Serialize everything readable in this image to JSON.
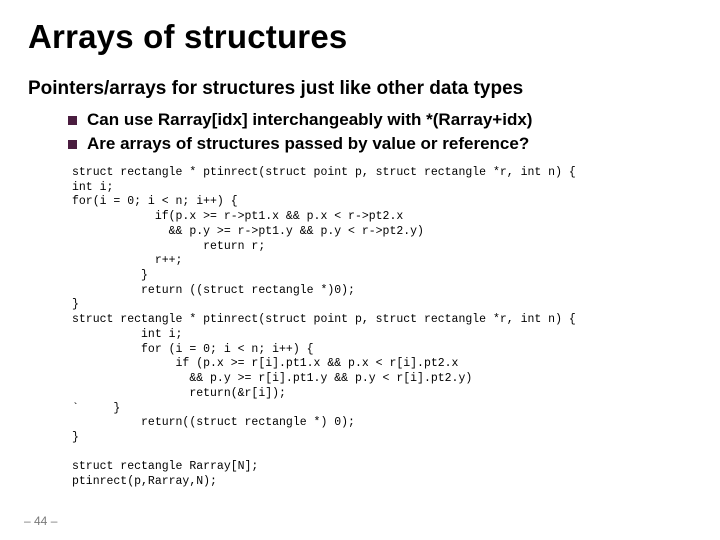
{
  "title": "Arrays of structures",
  "subtitle": "Pointers/arrays for structures just like other data types",
  "bullets": [
    "Can use Rarray[idx] interchangeably with *(Rarray+idx)",
    "Are arrays of structures passed by value or reference?"
  ],
  "code": "struct rectangle * ptinrect(struct point p, struct rectangle *r, int n) {\nint i;\nfor(i = 0; i < n; i++) {\n            if(p.x >= r->pt1.x && p.x < r->pt2.x\n              && p.y >= r->pt1.y && p.y < r->pt2.y)\n                   return r;\n            r++;\n          }\n          return ((struct rectangle *)0);\n}\nstruct rectangle * ptinrect(struct point p, struct rectangle *r, int n) {\n          int i;\n          for (i = 0; i < n; i++) {\n               if (p.x >= r[i].pt1.x && p.x < r[i].pt2.x\n                 && p.y >= r[i].pt1.y && p.y < r[i].pt2.y)\n                 return(&r[i]);\n`     }\n          return((struct rectangle *) 0);\n}\n\nstruct rectangle Rarray[N];\nptinrect(p,Rarray,N);",
  "page_number": "– 44 –"
}
